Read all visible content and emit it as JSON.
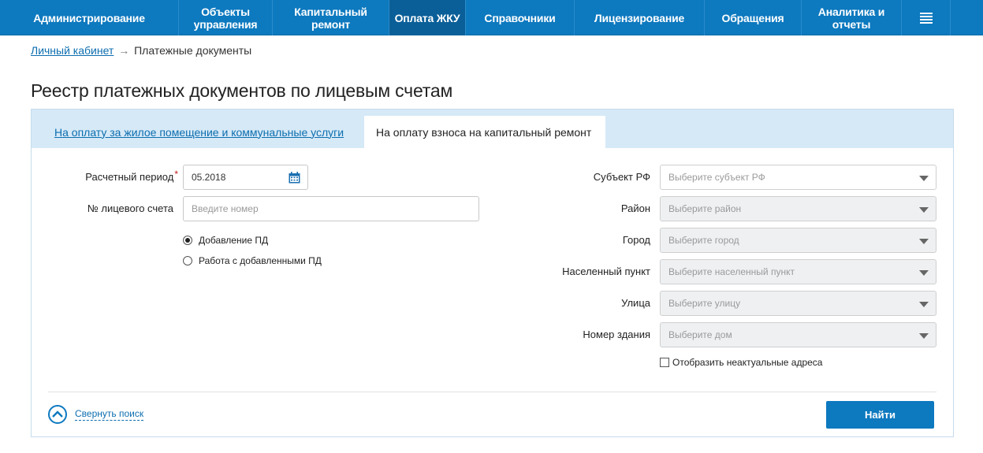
{
  "nav": {
    "items": [
      {
        "label": "Администрирование"
      },
      {
        "label": "Объекты управления"
      },
      {
        "label": "Капитальный ремонт"
      },
      {
        "label": "Оплата ЖКУ"
      },
      {
        "label": "Справочники"
      },
      {
        "label": "Лицензирование"
      },
      {
        "label": "Обращения"
      },
      {
        "label": "Аналитика и отчеты"
      }
    ],
    "menu_icon": "menu-icon",
    "active_index": 3,
    "color": "#0d79bf"
  },
  "breadcrumb": {
    "home": "Личный кабинет",
    "separator": "→",
    "current": "Платежные документы"
  },
  "page": {
    "title": "Реестр платежных документов по лицевым счетам"
  },
  "tabs": {
    "housing": "На оплату за жилое помещение и коммунальные услуги",
    "capital": "На оплату взноса на капитальный ремонт"
  },
  "form": {
    "period_label": "Расчетный период",
    "required_mark": "*",
    "period_value": "05.2018",
    "account_label": "№ лицевого счета",
    "account_placeholder": "Введите номер",
    "radio_add": "Добавление ПД",
    "radio_work": "Работа с добавленными ПД",
    "subject_label": "Субъект РФ",
    "subject_placeholder": "Выберите субъект РФ",
    "district_label": "Район",
    "district_placeholder": "Выберите район",
    "city_label": "Город",
    "city_placeholder": "Выберите город",
    "locality_label": "Населенный пункт",
    "locality_placeholder": "Выберите населенный пункт",
    "street_label": "Улица",
    "street_placeholder": "Выберите улицу",
    "building_label": "Номер здания",
    "building_placeholder": "Выберите дом",
    "show_inactive": "Отобразить неактуальные адреса"
  },
  "actions": {
    "collapse": "Свернуть поиск",
    "find": "Найти"
  }
}
